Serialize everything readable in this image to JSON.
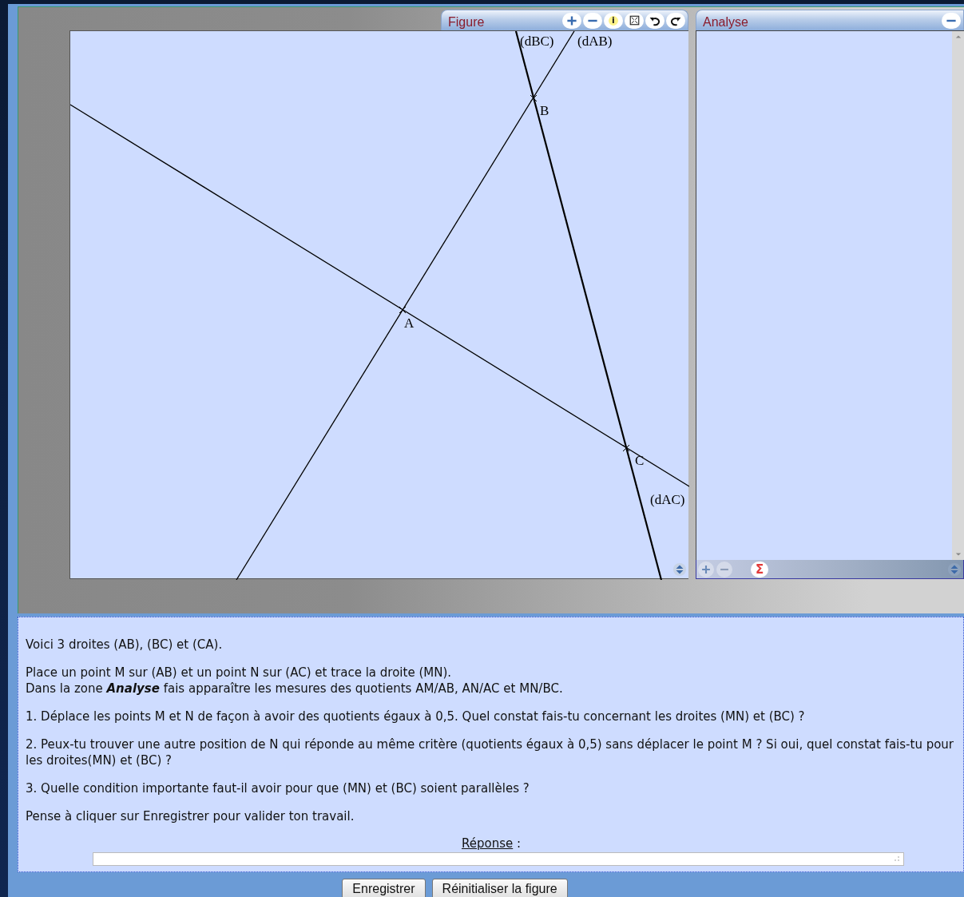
{
  "figure": {
    "title": "Figure",
    "toolbar": [
      {
        "kind": "plus"
      },
      {
        "kind": "minus"
      },
      {
        "kind": "info",
        "label": "i"
      },
      {
        "kind": "fit"
      },
      {
        "kind": "undo"
      },
      {
        "kind": "redo"
      }
    ],
    "line_labels": [
      "(dBC)",
      "(dAB)",
      "(dAC)"
    ],
    "point_labels": [
      "B",
      "A",
      "C"
    ]
  },
  "analyse": {
    "title": "Analyse",
    "header_tools": [
      {
        "kind": "minus"
      }
    ],
    "toolbar": [
      {
        "kind": "plus"
      },
      {
        "kind": "minus"
      },
      {
        "kind": "sum",
        "label": "Σ"
      }
    ]
  },
  "instructions": [
    [
      "Voici 3 droites (AB), (BC) et (CA)."
    ],
    [
      "Place un point M sur (AB) et un point N sur (AC) et trace la droite (MN).",
      "Dans la zone **Analyse** fais apparaître les mesures des quotients AM/AB, AN/AC et MN/BC."
    ],
    [
      "1. Déplace les points M et N de façon à avoir des quotients égaux à 0,5. Quel constat fais-tu concernant les droites (MN) et (BC) ?"
    ],
    [
      "2. Peux-tu trouver une autre position de N qui réponde au même critère (quotients égaux à 0,5) sans déplacer le point M ? Si oui, quel constat fais-tu pour les droites(MN) et (BC) ?"
    ],
    [
      "3. Quelle condition importante faut-il avoir pour que (MN) et (BC) soient parallèles ?"
    ],
    [
      "Pense à cliquer sur Enregistrer pour valider ton travail."
    ]
  ],
  "answer": {
    "label": "Réponse",
    "suffix": " :"
  },
  "buttons": [
    "Enregistrer",
    "Réinitialiser la figure"
  ]
}
